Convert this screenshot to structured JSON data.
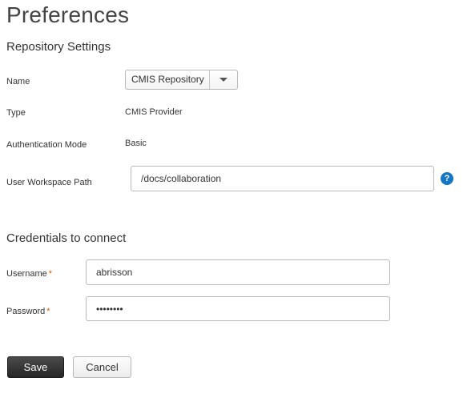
{
  "page": {
    "title": "Preferences"
  },
  "repository": {
    "section_title": "Repository Settings",
    "name_label": "Name",
    "name_value": "CMIS Repository",
    "type_label": "Type",
    "type_value": "CMIS Provider",
    "auth_label": "Authentication Mode",
    "auth_value": "Basic",
    "workspace_label": "User Workspace Path",
    "workspace_value": "/docs/collaboration",
    "help_glyph": "?"
  },
  "credentials": {
    "section_title": "Credentials to connect",
    "username_label": "Username",
    "username_value": "abrisson",
    "password_label": "Password",
    "password_value": "********",
    "required_marker": "*"
  },
  "actions": {
    "save_label": "Save",
    "cancel_label": "Cancel"
  },
  "colors": {
    "accent": "#1477c4",
    "required": "#e05a00",
    "primary_button": "#333333"
  },
  "icons": {
    "help": "help-icon",
    "dropdown": "chevron-down-icon"
  }
}
